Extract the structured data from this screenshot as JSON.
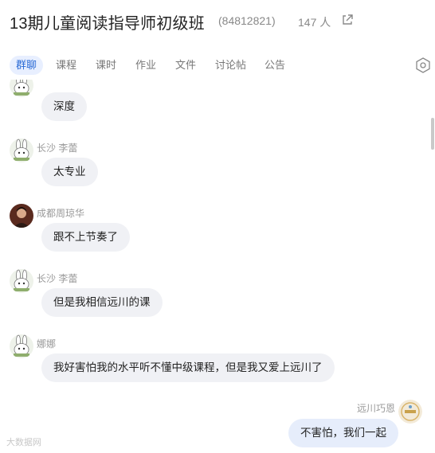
{
  "header": {
    "title": "13期儿童阅读指导师初级班",
    "group_id": "(84812821)",
    "member_count": "147 人"
  },
  "tabs": [
    "群聊",
    "课程",
    "课时",
    "作业",
    "文件",
    "讨论帖",
    "公告"
  ],
  "active_tab": "群聊",
  "messages": [
    {
      "sender": "",
      "text": "深度",
      "side": "left",
      "avatar": "rabbit"
    },
    {
      "sender": "长沙 李蕾",
      "text": "太专业",
      "side": "left",
      "avatar": "rabbit"
    },
    {
      "sender": "成都周琼华",
      "text": "跟不上节奏了",
      "side": "left",
      "avatar": "photo"
    },
    {
      "sender": "长沙 李蕾",
      "text": "但是我相信远川的课",
      "side": "left",
      "avatar": "rabbit"
    },
    {
      "sender": "娜娜",
      "text": "我好害怕我的水平听不懂中级课程，但是我又爱上远川了",
      "side": "left",
      "avatar": "rabbit"
    },
    {
      "sender": "远川巧恩",
      "text": "不害怕，我们一起",
      "side": "right",
      "avatar": "badge"
    }
  ],
  "watermark": "大数据网",
  "colors": {
    "accent": "#2b6bd6",
    "bubble_left": "#f0f1f5",
    "bubble_right": "#e6edfb"
  }
}
